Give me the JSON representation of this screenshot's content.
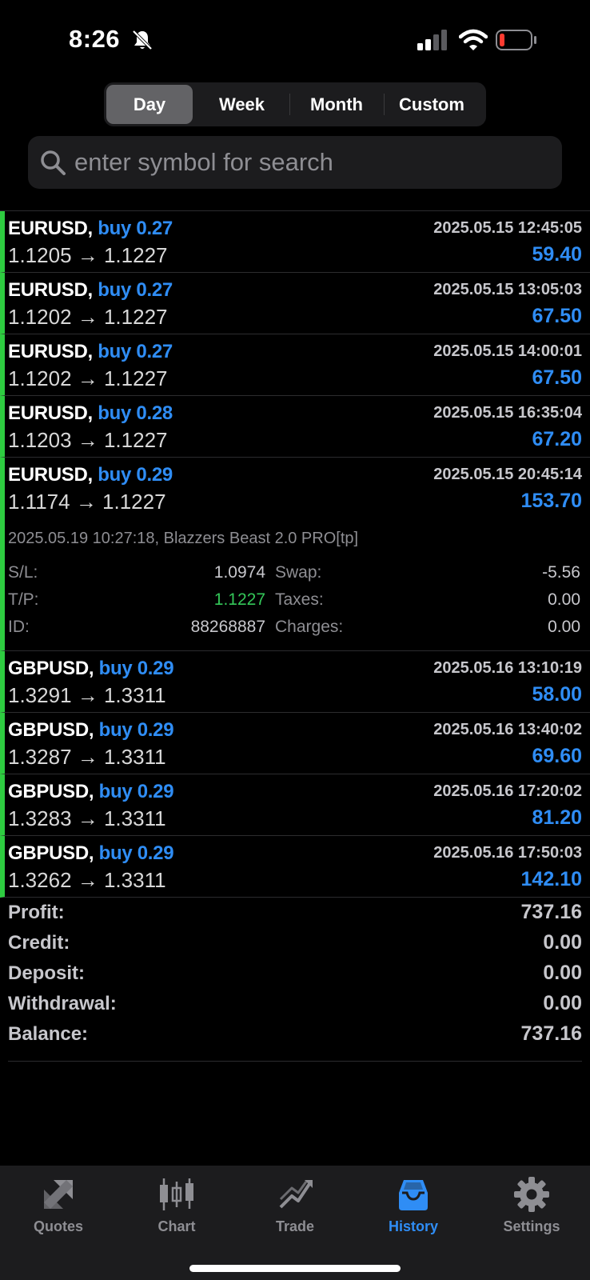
{
  "status_bar": {
    "time": "8:26"
  },
  "periods": [
    {
      "label": "Day",
      "active": true
    },
    {
      "label": "Week",
      "active": false
    },
    {
      "label": "Month",
      "active": false
    },
    {
      "label": "Custom",
      "active": false
    }
  ],
  "search": {
    "placeholder": "enter symbol for search"
  },
  "trades": [
    {
      "symbol": "EURUSD,",
      "side": "buy 0.27",
      "prices": "1.1205 → 1.1227",
      "time": "2025.05.15 12:45:05",
      "profit": "59.40"
    },
    {
      "symbol": "EURUSD,",
      "side": "buy 0.27",
      "prices": "1.1202 → 1.1227",
      "time": "2025.05.15 13:05:03",
      "profit": "67.50"
    },
    {
      "symbol": "EURUSD,",
      "side": "buy 0.27",
      "prices": "1.1202 → 1.1227",
      "time": "2025.05.15 14:00:01",
      "profit": "67.50"
    },
    {
      "symbol": "EURUSD,",
      "side": "buy 0.28",
      "prices": "1.1203 → 1.1227",
      "time": "2025.05.15 16:35:04",
      "profit": "67.20"
    },
    {
      "symbol": "EURUSD,",
      "side": "buy 0.29",
      "prices": "1.1174 → 1.1227",
      "time": "2025.05.15 20:45:14",
      "profit": "153.70"
    },
    {
      "symbol": "GBPUSD,",
      "side": "buy 0.29",
      "prices": "1.3291 → 1.3311",
      "time": "2025.05.16 13:10:19",
      "profit": "58.00"
    },
    {
      "symbol": "GBPUSD,",
      "side": "buy 0.29",
      "prices": "1.3287 → 1.3311",
      "time": "2025.05.16 13:40:02",
      "profit": "69.60"
    },
    {
      "symbol": "GBPUSD,",
      "side": "buy 0.29",
      "prices": "1.3283 → 1.3311",
      "time": "2025.05.16 17:20:02",
      "profit": "81.20"
    },
    {
      "symbol": "GBPUSD,",
      "side": "buy 0.29",
      "prices": "1.3262 → 1.3311",
      "time": "2025.05.16 17:50:03",
      "profit": "142.10"
    }
  ],
  "expanded": {
    "info": "2025.05.19 10:27:18, Blazzers Beast 2.0 PRO[tp]",
    "sl_label": "S/L:",
    "sl_value": "1.0974",
    "tp_label": "T/P:",
    "tp_value": "1.1227",
    "id_label": "ID:",
    "id_value": "88268887",
    "swap_label": "Swap:",
    "swap_value": "-5.56",
    "taxes_label": "Taxes:",
    "taxes_value": "0.00",
    "charges_label": "Charges:",
    "charges_value": "0.00"
  },
  "summary": [
    {
      "label": "Profit:",
      "value": "737.16"
    },
    {
      "label": "Credit:",
      "value": "0.00"
    },
    {
      "label": "Deposit:",
      "value": "0.00"
    },
    {
      "label": "Withdrawal:",
      "value": "0.00"
    },
    {
      "label": "Balance:",
      "value": "737.16"
    }
  ],
  "tabs": [
    {
      "label": "Quotes",
      "icon": "quotes-icon"
    },
    {
      "label": "Chart",
      "icon": "chart-icon"
    },
    {
      "label": "Trade",
      "icon": "trade-icon"
    },
    {
      "label": "History",
      "icon": "history-icon",
      "active": true
    },
    {
      "label": "Settings",
      "icon": "gear-icon"
    }
  ],
  "colors": {
    "accent": "#2f8df5",
    "profit_bar": "#2ecc40",
    "tp_green": "#34c759",
    "battery_low": "#ff3b30"
  }
}
